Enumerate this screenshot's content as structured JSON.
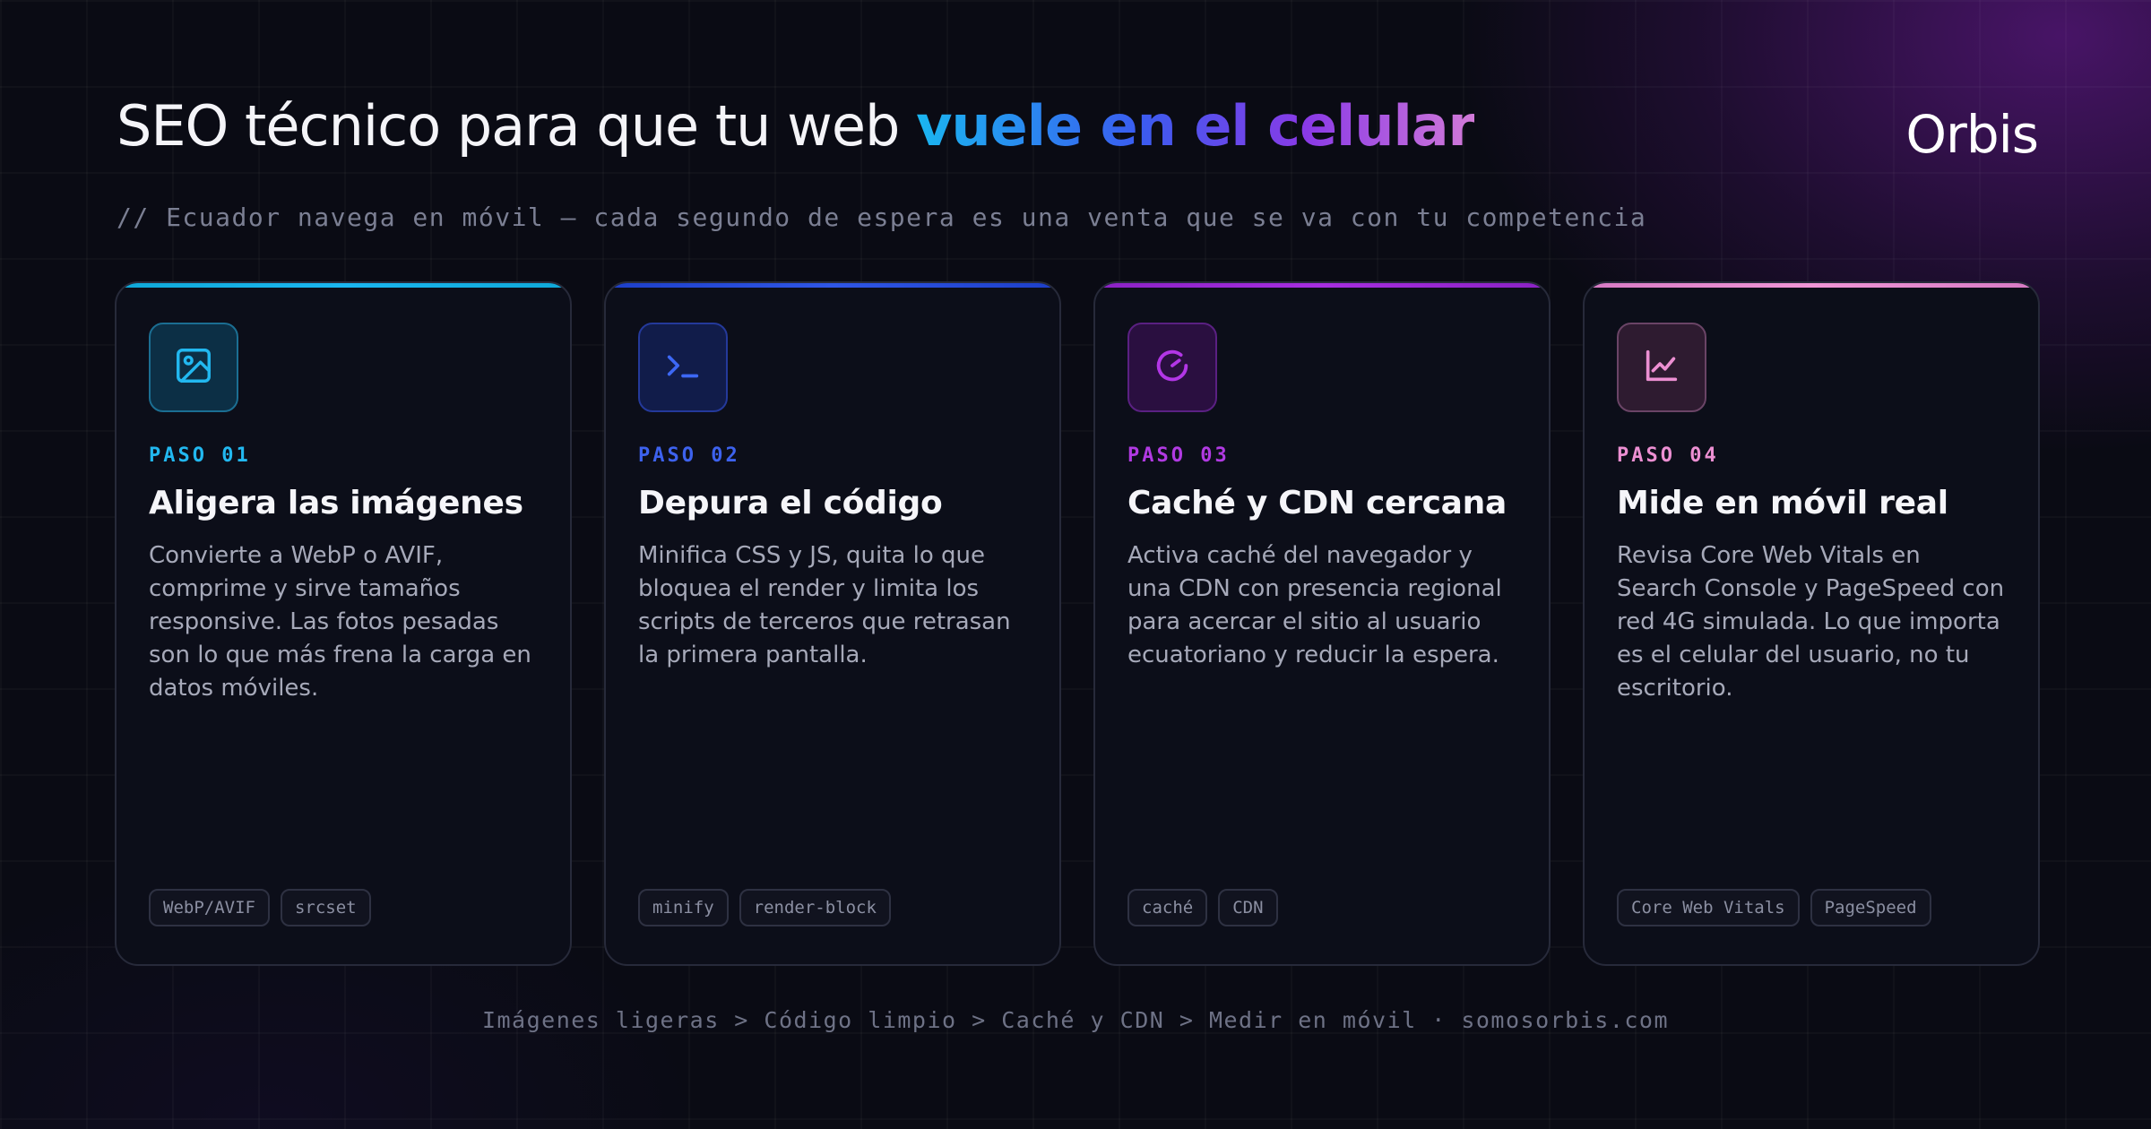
{
  "header": {
    "title_main": "SEO técnico para que tu web ",
    "title_accent": "vuele en el celular",
    "logo": "Orbis",
    "subtitle": "// Ecuador navega en móvil — cada segundo de espera es una venta que se va con tu competencia"
  },
  "cards": [
    {
      "step": "PASO 01",
      "title": "Aligera las imágenes",
      "description": "Convierte a WebP o AVIF, comprime y sirve tamaños responsive. Las fotos pesadas son lo que más frena la carga en datos móviles.",
      "icon": "image-icon",
      "accent": "#1ab6f0",
      "tags": [
        "WebP/AVIF",
        "srcset"
      ]
    },
    {
      "step": "PASO 02",
      "title": "Depura el código",
      "description": "Minifica CSS y JS, quita lo que bloquea el render y limita los scripts de terceros que retrasan la primera pantalla.",
      "icon": "terminal-icon",
      "accent": "#2f56e6",
      "tags": [
        "minify",
        "render-block"
      ]
    },
    {
      "step": "PASO 03",
      "title": "Caché y CDN cercana",
      "description": "Activa caché del navegador y una CDN con presencia regional para acercar el sitio al usuario ecuatoriano y reducir la espera.",
      "icon": "gauge-icon",
      "accent": "#a02ad8",
      "tags": [
        "caché",
        "CDN"
      ]
    },
    {
      "step": "PASO 04",
      "title": "Mide en móvil real",
      "description": "Revisa Core Web Vitals en Search Console y PageSpeed con red 4G simulada. Lo que importa es el celular del usuario, no tu escritorio.",
      "icon": "chart-line-icon",
      "accent": "#e88ad0",
      "tags": [
        "Core Web Vitals",
        "PageSpeed"
      ]
    }
  ],
  "footer": {
    "text": "Imágenes ligeras > Código limpio > Caché y CDN > Medir en móvil · somosorbis.com"
  }
}
